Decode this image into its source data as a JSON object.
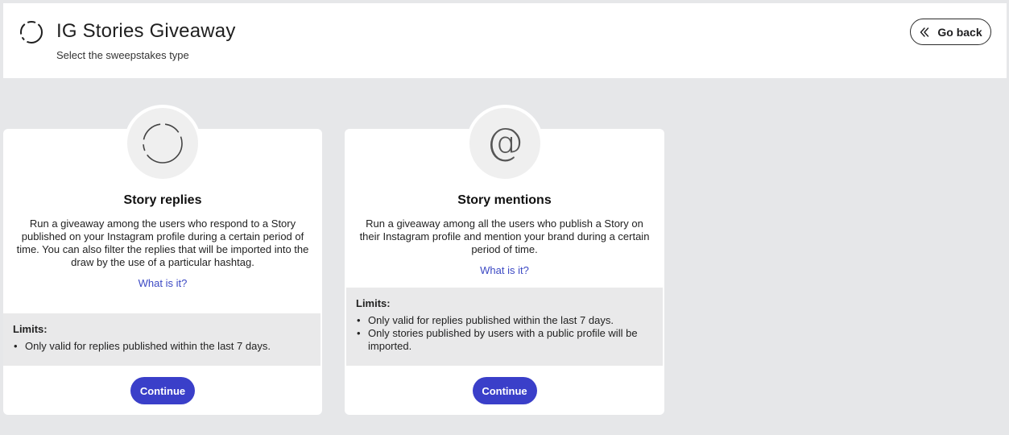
{
  "header": {
    "title": "IG Stories Giveaway",
    "subtitle": "Select the sweepstakes type",
    "go_back_label": "Go back"
  },
  "cards": [
    {
      "title": "Story replies",
      "description": "Run a giveaway among the users who respond to a Story published on your Instagram profile during a certain period of time. You can also filter the replies that will be imported into the draw by the use of a particular hashtag.",
      "link": "What is it?",
      "limits_title": "Limits:",
      "limits": [
        "Only valid for replies published within the last 7 days."
      ],
      "continue_label": "Continue",
      "icon": "dashed-circle-icon"
    },
    {
      "title": "Story mentions",
      "description": "Run a giveaway among all the users who publish a Story on their Instagram profile and mention your brand during a certain period of time.",
      "link": "What is it?",
      "limits_title": "Limits:",
      "limits": [
        "Only valid for replies published within the last 7 days.",
        "Only stories published by users with a public profile will be imported."
      ],
      "continue_label": "Continue",
      "icon": "at-sign-icon"
    }
  ],
  "colors": {
    "accent": "#3a3fc9",
    "link": "#3c49c4",
    "background": "#e6e7e9"
  }
}
